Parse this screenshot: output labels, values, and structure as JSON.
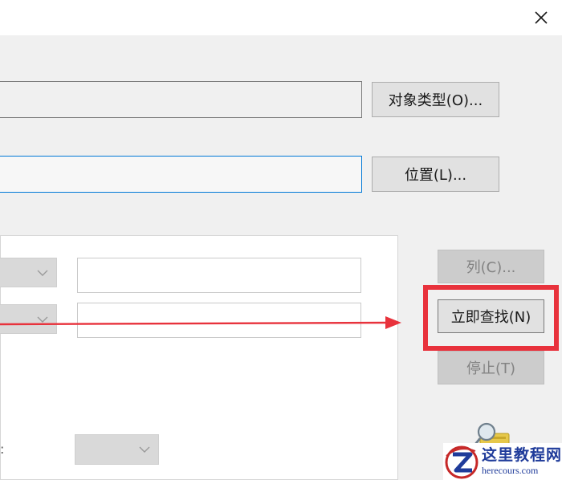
{
  "dialog": {
    "close_glyph": "×"
  },
  "buttons": {
    "object_types": "对象类型(O)...",
    "locations": "位置(L)...",
    "columns": "列(C)...",
    "find_now": "立即查找(N)",
    "stop": "停止(T)"
  },
  "query_panel": {
    "colon_label": ":"
  },
  "watermark": {
    "cn": "这里教程网",
    "en": "herecours.com"
  },
  "colors": {
    "highlight": "#e8323c",
    "focus_border": "#0078d7",
    "watermark_blue": "#1f3b9a"
  }
}
